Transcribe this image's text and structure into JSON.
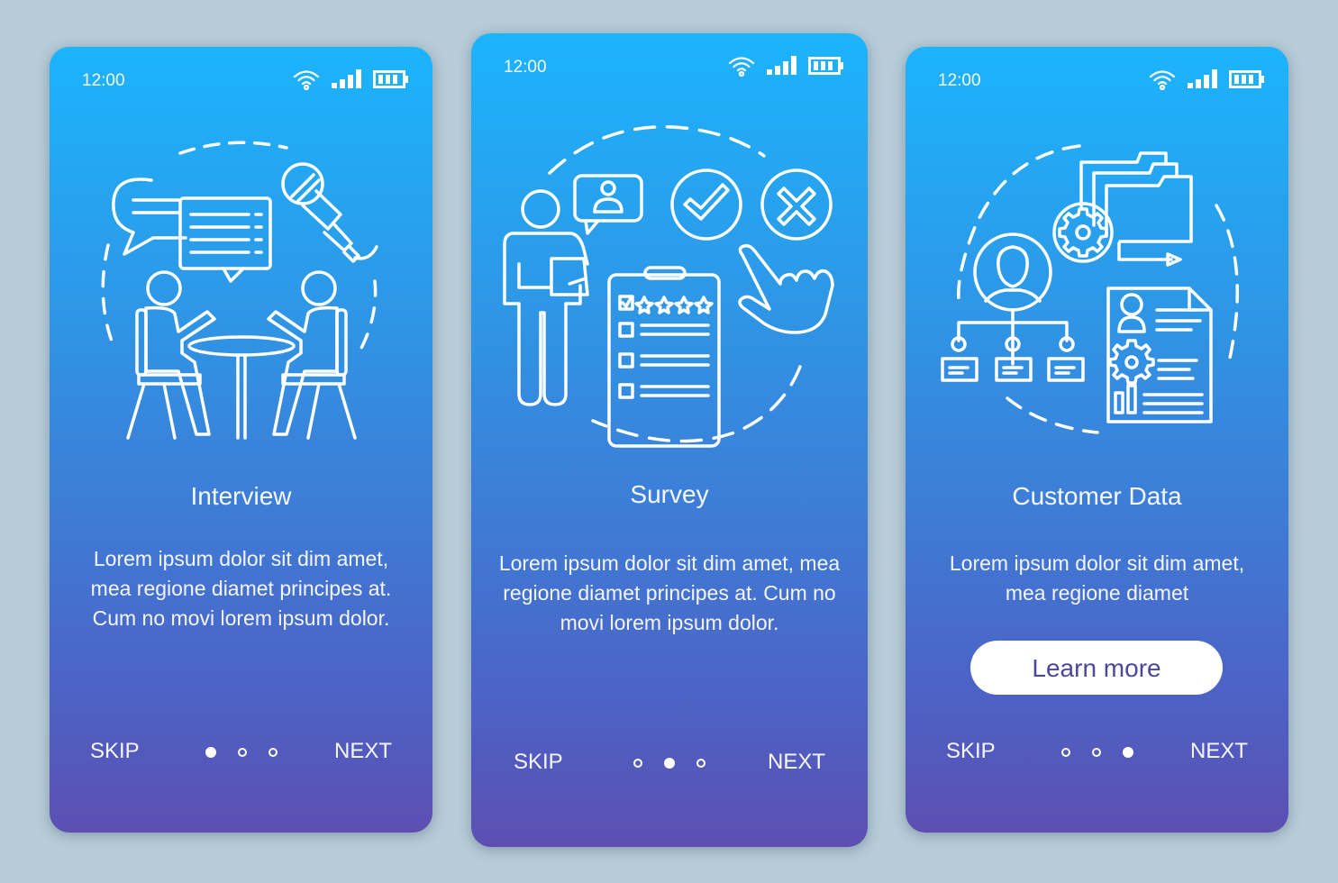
{
  "colors": {
    "background": "#b6ccd8",
    "gradient_top": "#1cb4fd",
    "gradient_bottom": "#5d4fb2",
    "button_text": "#4a479c",
    "foreground": "#ffffff"
  },
  "screens": [
    {
      "status": {
        "time": "12:00",
        "icons": [
          "wifi-icon",
          "signal-icon",
          "battery-icon"
        ]
      },
      "illustration": "interview-illustration",
      "title": "Interview",
      "body": "Lorem ipsum dolor sit dim amet, mea regione diamet principes at. Cum no movi lorem ipsum dolor.",
      "footer": {
        "skip": "SKIP",
        "next": "NEXT",
        "page_count": 3,
        "active_page": 1
      }
    },
    {
      "status": {
        "time": "12:00",
        "icons": [
          "wifi-icon",
          "signal-icon",
          "battery-icon"
        ]
      },
      "illustration": "survey-illustration",
      "title": "Survey",
      "body": "Lorem ipsum dolor sit dim amet, mea regione diamet principes at. Cum no movi lorem ipsum dolor.",
      "footer": {
        "skip": "SKIP",
        "next": "NEXT",
        "page_count": 3,
        "active_page": 2
      }
    },
    {
      "status": {
        "time": "12:00",
        "icons": [
          "wifi-icon",
          "signal-icon",
          "battery-icon"
        ]
      },
      "illustration": "customer-data-illustration",
      "title": "Customer Data",
      "body": "Lorem ipsum dolor sit dim amet, mea regione diamet",
      "button": "Learn more",
      "footer": {
        "skip": "SKIP",
        "next": "NEXT",
        "page_count": 3,
        "active_page": 3
      }
    }
  ]
}
